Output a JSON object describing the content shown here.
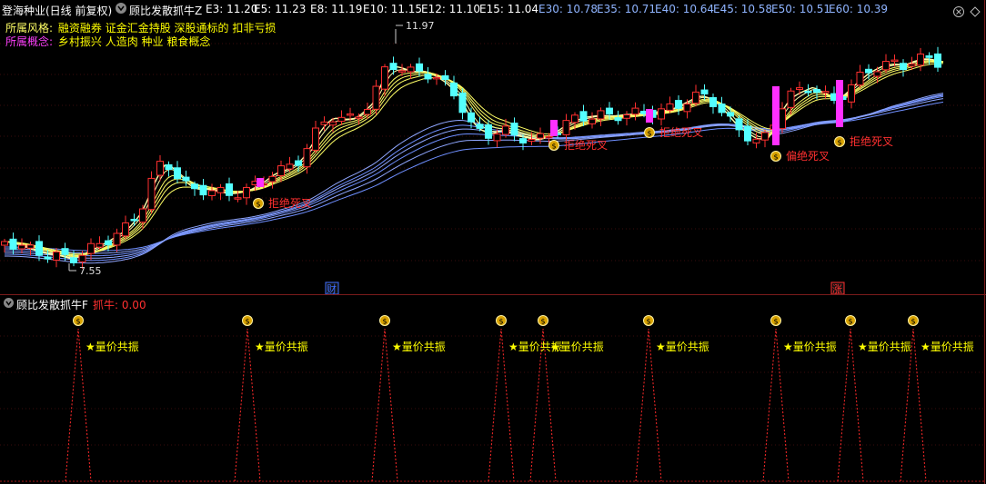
{
  "header": {
    "stock_name": "登海种业",
    "period": "(日线 前复权)",
    "indicator": "顾比发散抓牛Z",
    "emas": [
      {
        "label": "E3: 11.20",
        "color": "#ffffff"
      },
      {
        "label": "E5: 11.23",
        "color": "#ffffff"
      },
      {
        "label": "E8: 11.19",
        "color": "#ffffff"
      },
      {
        "label": "E10: 11.15",
        "color": "#ffffff"
      },
      {
        "label": "E12: 11.10",
        "color": "#ffffff"
      },
      {
        "label": "E15: 11.04",
        "color": "#ffffff"
      },
      {
        "label": "E30: 10.78",
        "color": "#8fb4ff"
      },
      {
        "label": "E35: 10.71",
        "color": "#8fb4ff"
      },
      {
        "label": "E40: 10.64",
        "color": "#8fb4ff"
      },
      {
        "label": "E45: 10.58",
        "color": "#8fb4ff"
      },
      {
        "label": "E50: 10.51",
        "color": "#8fb4ff"
      },
      {
        "label": "E60: 10.39",
        "color": "#8fb4ff"
      }
    ]
  },
  "info": {
    "style_label": "所属风格:",
    "style_value": "融资融券 证金汇金持股 深股通标的 扣非亏损",
    "concept_label": "所属概念:",
    "concept_value": "乡村振兴 人造肉 种业 粮食概念"
  },
  "price_chart": {
    "high_label": "11.97",
    "low_label": "7.55",
    "signals": [
      "拒绝死叉",
      "拒绝死叉",
      "拒绝死叉",
      "偏绝死叉",
      "拒绝死叉"
    ],
    "markers": [
      "财",
      "涨"
    ]
  },
  "indicator_panel": {
    "name": "顾比发散抓牛F",
    "value_label": "抓牛: 0.00",
    "signal_text": "★量价共振",
    "signal_count": 10
  },
  "colors": {
    "up_candle": "#ff3030",
    "down_candle": "#54ffff",
    "fast_ema": "#ffff66",
    "slow_ema": "#6f8fff",
    "signal_text": "#ff3030",
    "label_yellow": "#ffff00",
    "label_magenta": "#ff40ff"
  }
}
